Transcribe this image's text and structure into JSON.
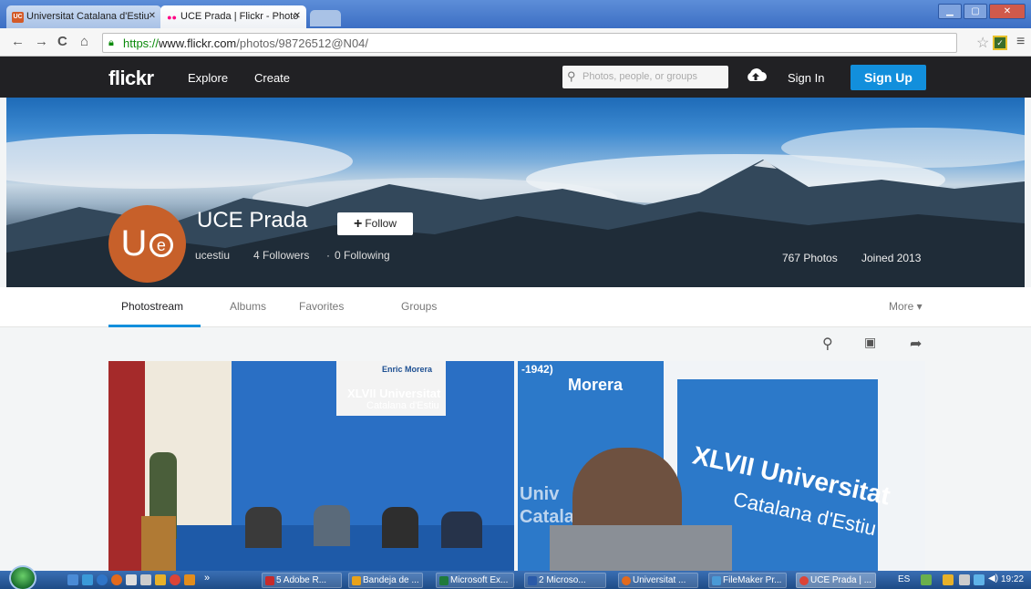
{
  "browser": {
    "tabs": [
      {
        "label": "Universitat Catalana d'Estiu",
        "favicon_text": "UC",
        "favicon_color": "#d35a28"
      },
      {
        "label": "UCE Prada | Flickr - Photo",
        "favicon_text": "●●",
        "favicon_color": "#ff0084"
      }
    ],
    "url_protocol": "https://",
    "url_host": "www.flickr.com",
    "url_path": "/photos/98726512@N04/"
  },
  "header": {
    "logo": "flickr",
    "nav": [
      "Explore",
      "Create"
    ],
    "search_placeholder": "Photos, people, or groups",
    "sign_in": "Sign In",
    "sign_up": "Sign Up"
  },
  "profile": {
    "avatar_text": "U",
    "avatar_letter": "e",
    "name": "UCE Prada",
    "follow_label": "Follow",
    "username": "ucestiu",
    "followers": "4 Followers",
    "separator": "·",
    "following": "0 Following",
    "photos": "767 Photos",
    "joined": "Joined 2013"
  },
  "subnav": {
    "items": [
      "Photostream",
      "Albums",
      "Favorites",
      "Groups"
    ],
    "active": "Photostream",
    "more": "More ▾"
  },
  "photos": {
    "p1_banner_title": "XLVII Universitat",
    "p1_banner_sub": "Catalana d'Estiu",
    "p1_name": "Enric Morera",
    "p2_text1": "XLVII Universitat",
    "p2_text2": "Catalana d'Estiu",
    "p2_top": "Morera",
    "p2_dates": "-1942)",
    "p2_side1": "Univ",
    "p2_side2": "Catala"
  },
  "taskbar": {
    "items": [
      "5 Adobe R...",
      "Bandeja de ...",
      "Microsoft Ex...",
      "2 Microso...",
      "Universitat ...",
      "FileMaker Pr...",
      "UCE Prada | ..."
    ],
    "lang": "ES",
    "time": "19:22"
  },
  "colors": {
    "flickr_blue": "#128fdc",
    "header_dark": "#212124",
    "avatar_orange": "#c7602a"
  }
}
